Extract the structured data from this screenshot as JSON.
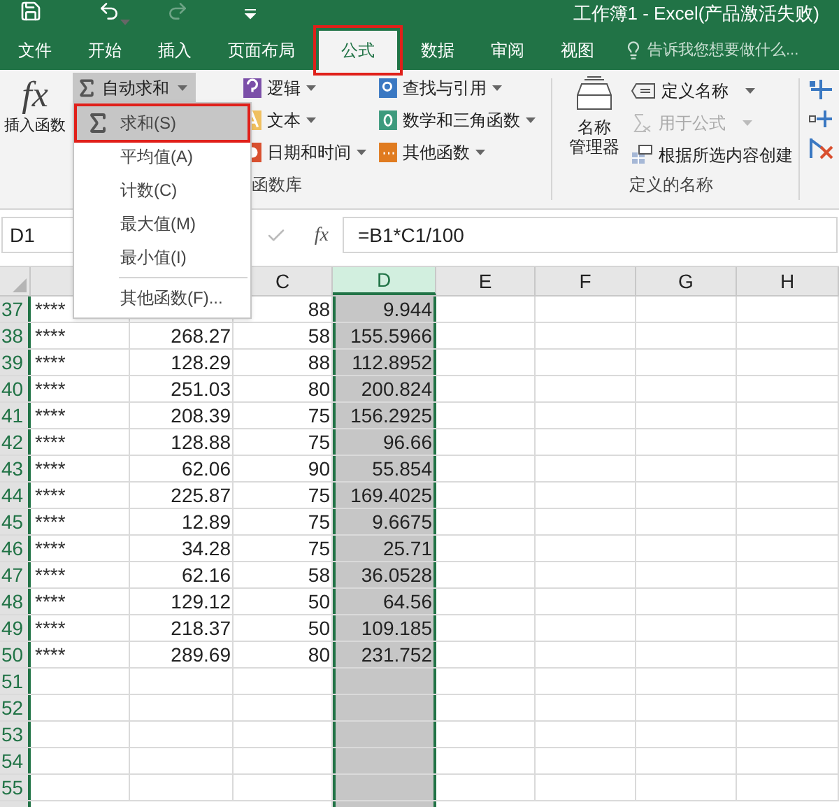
{
  "window": {
    "title": "工作簿1 - Excel(产品激活失败)"
  },
  "tabs": [
    {
      "label": "文件",
      "selected": false,
      "highlighted": false
    },
    {
      "label": "开始",
      "selected": false,
      "highlighted": false
    },
    {
      "label": "插入",
      "selected": false,
      "highlighted": false
    },
    {
      "label": "页面布局",
      "selected": false,
      "highlighted": false
    },
    {
      "label": "公式",
      "selected": true,
      "highlighted": true
    },
    {
      "label": "数据",
      "selected": false,
      "highlighted": false
    },
    {
      "label": "审阅",
      "selected": false,
      "highlighted": false
    },
    {
      "label": "视图",
      "selected": false,
      "highlighted": false
    }
  ],
  "tell_me": {
    "placeholder": "告诉我您想要做什么..."
  },
  "ribbon": {
    "insert_function": {
      "glyph": "fx",
      "label": "插入函数"
    },
    "autosum": {
      "label": "自动求和"
    },
    "function_columns": [
      [
        {
          "label": "逻辑",
          "kind": "logic"
        },
        {
          "label": "文本",
          "kind": "text"
        },
        {
          "label": "日期和时间",
          "kind": "date"
        }
      ],
      [
        {
          "label": "查找与引用",
          "kind": "lookup"
        },
        {
          "label": "数学和三角函数",
          "kind": "math"
        },
        {
          "label": "其他函数",
          "kind": "more"
        }
      ]
    ],
    "function_group_label": "函数库",
    "name_manager": {
      "label_lines": [
        "名称",
        "管理器"
      ]
    },
    "name_items": [
      {
        "label": "定义名称",
        "kind": "define",
        "disabled": false,
        "dropdown": true
      },
      {
        "label": "用于公式",
        "kind": "formula",
        "disabled": true,
        "dropdown": true
      },
      {
        "label": "根据所选内容创建",
        "kind": "create",
        "disabled": false,
        "dropdown": false
      }
    ],
    "names_group_label": "定义的名称"
  },
  "autosum_menu": [
    {
      "label": "求和(S)",
      "selected": true,
      "highlighted": true,
      "icon": true
    },
    {
      "label": "平均值(A)",
      "selected": false,
      "highlighted": false,
      "icon": false
    },
    {
      "label": "计数(C)",
      "selected": false,
      "highlighted": false,
      "icon": false
    },
    {
      "label": "最大值(M)",
      "selected": false,
      "highlighted": false,
      "icon": false
    },
    {
      "label": "最小值(I)",
      "selected": false,
      "highlighted": false,
      "icon": false
    },
    {
      "label": "其他函数(F)...",
      "selected": false,
      "highlighted": false,
      "icon": false,
      "separator_before": true
    }
  ],
  "formula_bar": {
    "name_box": "D1",
    "fx": "fx",
    "formula": "=B1*C1/100"
  },
  "columns": [
    {
      "label": "C",
      "selected": false
    },
    {
      "label": "D",
      "selected": true
    },
    {
      "label": "E",
      "selected": false
    },
    {
      "label": "F",
      "selected": false
    },
    {
      "label": "G",
      "selected": false
    },
    {
      "label": "H",
      "selected": false
    }
  ],
  "rows": [
    {
      "number": "37",
      "a": "****",
      "c": "88",
      "d": "9.944"
    },
    {
      "number": "38",
      "a": "****",
      "b": "268.27",
      "c": "58",
      "d": "155.5966"
    },
    {
      "number": "39",
      "a": "****",
      "b": "128.29",
      "c": "88",
      "d": "112.8952"
    },
    {
      "number": "40",
      "a": "****",
      "b": "251.03",
      "c": "80",
      "d": "200.824"
    },
    {
      "number": "41",
      "a": "****",
      "b": "208.39",
      "c": "75",
      "d": "156.2925"
    },
    {
      "number": "42",
      "a": "****",
      "b": "128.88",
      "c": "75",
      "d": "96.66"
    },
    {
      "number": "43",
      "a": "****",
      "b": "62.06",
      "c": "90",
      "d": "55.854"
    },
    {
      "number": "44",
      "a": "****",
      "b": "225.87",
      "c": "75",
      "d": "169.4025"
    },
    {
      "number": "45",
      "a": "****",
      "b": "12.89",
      "c": "75",
      "d": "9.6675"
    },
    {
      "number": "46",
      "a": "****",
      "b": "34.28",
      "c": "75",
      "d": "25.71"
    },
    {
      "number": "47",
      "a": "****",
      "b": "62.16",
      "c": "58",
      "d": "36.0528"
    },
    {
      "number": "48",
      "a": "****",
      "b": "129.12",
      "c": "50",
      "d": "64.56"
    },
    {
      "number": "49",
      "a": "****",
      "b": "218.37",
      "c": "50",
      "d": "109.185"
    },
    {
      "number": "50",
      "a": "****",
      "b": "289.69",
      "c": "80",
      "d": "231.752"
    },
    {
      "number": "51"
    },
    {
      "number": "52"
    },
    {
      "number": "53"
    },
    {
      "number": "54"
    },
    {
      "number": "55"
    }
  ]
}
